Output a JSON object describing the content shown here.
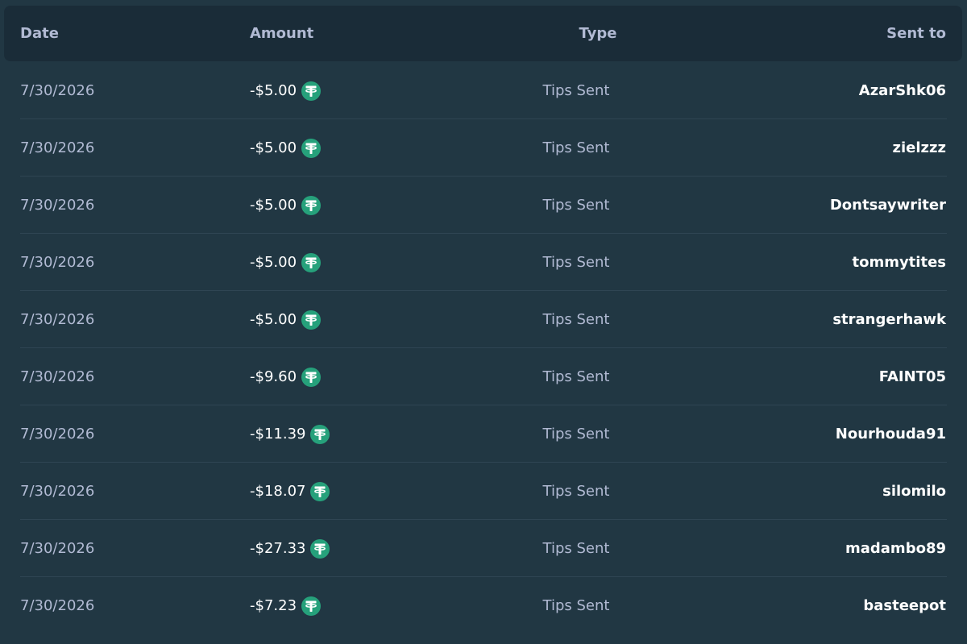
{
  "header": {
    "date": "Date",
    "amount": "Amount",
    "type": "Type",
    "sent_to": "Sent to"
  },
  "rows": [
    {
      "date": "7/30/2026",
      "amount": "-$5.00",
      "type": "Tips Sent",
      "sent_to": "AzarShk06"
    },
    {
      "date": "7/30/2026",
      "amount": "-$5.00",
      "type": "Tips Sent",
      "sent_to": "zielzzz"
    },
    {
      "date": "7/30/2026",
      "amount": "-$5.00",
      "type": "Tips Sent",
      "sent_to": "Dontsaywriter"
    },
    {
      "date": "7/30/2026",
      "amount": "-$5.00",
      "type": "Tips Sent",
      "sent_to": "tommytites"
    },
    {
      "date": "7/30/2026",
      "amount": "-$5.00",
      "type": "Tips Sent",
      "sent_to": "strangerhawk"
    },
    {
      "date": "7/30/2026",
      "amount": "-$9.60",
      "type": "Tips Sent",
      "sent_to": "FAINT05"
    },
    {
      "date": "7/30/2026",
      "amount": "-$11.39",
      "type": "Tips Sent",
      "sent_to": "Nourhouda91"
    },
    {
      "date": "7/30/2026",
      "amount": "-$18.07",
      "type": "Tips Sent",
      "sent_to": "silomilo"
    },
    {
      "date": "7/30/2026",
      "amount": "-$27.33",
      "type": "Tips Sent",
      "sent_to": "madambo89"
    },
    {
      "date": "7/30/2026",
      "amount": "-$7.23",
      "type": "Tips Sent",
      "sent_to": "basteepot"
    }
  ],
  "currency_icon": "tether-usdt-icon",
  "colors": {
    "background": "#213743",
    "header_background": "#1a2c38",
    "muted_text": "#b1bad3",
    "primary_text": "#ffffff",
    "divider": "#2f4553",
    "coin": "#26a17b"
  }
}
